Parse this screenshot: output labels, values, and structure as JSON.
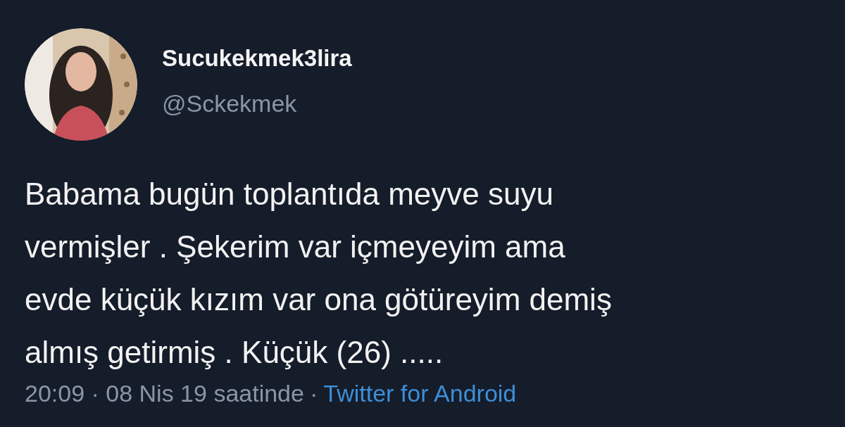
{
  "author": {
    "display_name": "Sucukekmek3lira",
    "handle": "@Sckekmek"
  },
  "tweet": {
    "text": "Babama bugün toplantıda meyve suyu\nvermişler . Şekerim var içmeyeyim ama\nevde küçük kızım var ona götüreyim demiş\nalmış getirmiş . Küçük (26) ....."
  },
  "footer": {
    "timestamp": "20:09 · 08 Nis 19 saatinde",
    "separator": "·",
    "source": "Twitter for Android"
  }
}
